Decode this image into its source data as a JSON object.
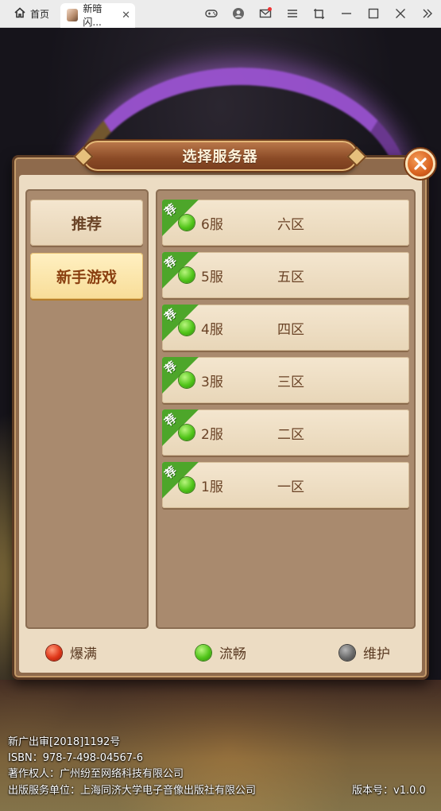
{
  "browser": {
    "home_tab_label": "首页",
    "game_tab_label": "新暗闪...",
    "tab_close": "✕"
  },
  "dialog": {
    "title": "选择服务器",
    "categories": [
      {
        "label": "推荐",
        "active": false
      },
      {
        "label": "新手游戏",
        "active": true
      }
    ],
    "servers": [
      {
        "tag": "荐",
        "name": "6服",
        "zone": "六区",
        "status": "green"
      },
      {
        "tag": "荐",
        "name": "5服",
        "zone": "五区",
        "status": "green"
      },
      {
        "tag": "荐",
        "name": "4服",
        "zone": "四区",
        "status": "green"
      },
      {
        "tag": "荐",
        "name": "3服",
        "zone": "三区",
        "status": "green"
      },
      {
        "tag": "荐",
        "name": "2服",
        "zone": "二区",
        "status": "green"
      },
      {
        "tag": "荐",
        "name": "1服",
        "zone": "一区",
        "status": "green"
      }
    ],
    "legend": {
      "full": "爆满",
      "smooth": "流畅",
      "maintenance": "维护"
    }
  },
  "footer": {
    "line1": "新广出审[2018]1192号",
    "line2": "ISBN：978-7-498-04567-6",
    "line3": "著作权人：广州纷至网络科技有限公司",
    "line4": "出版服务单位：上海同济大学电子音像出版社有限公司",
    "version": "版本号：v1.0.0"
  },
  "colors": {
    "status_full": "#e0381a",
    "status_smooth": "#52c51a",
    "status_maintenance": "#6b6b6b",
    "recommend_tag": "#4da62a"
  }
}
